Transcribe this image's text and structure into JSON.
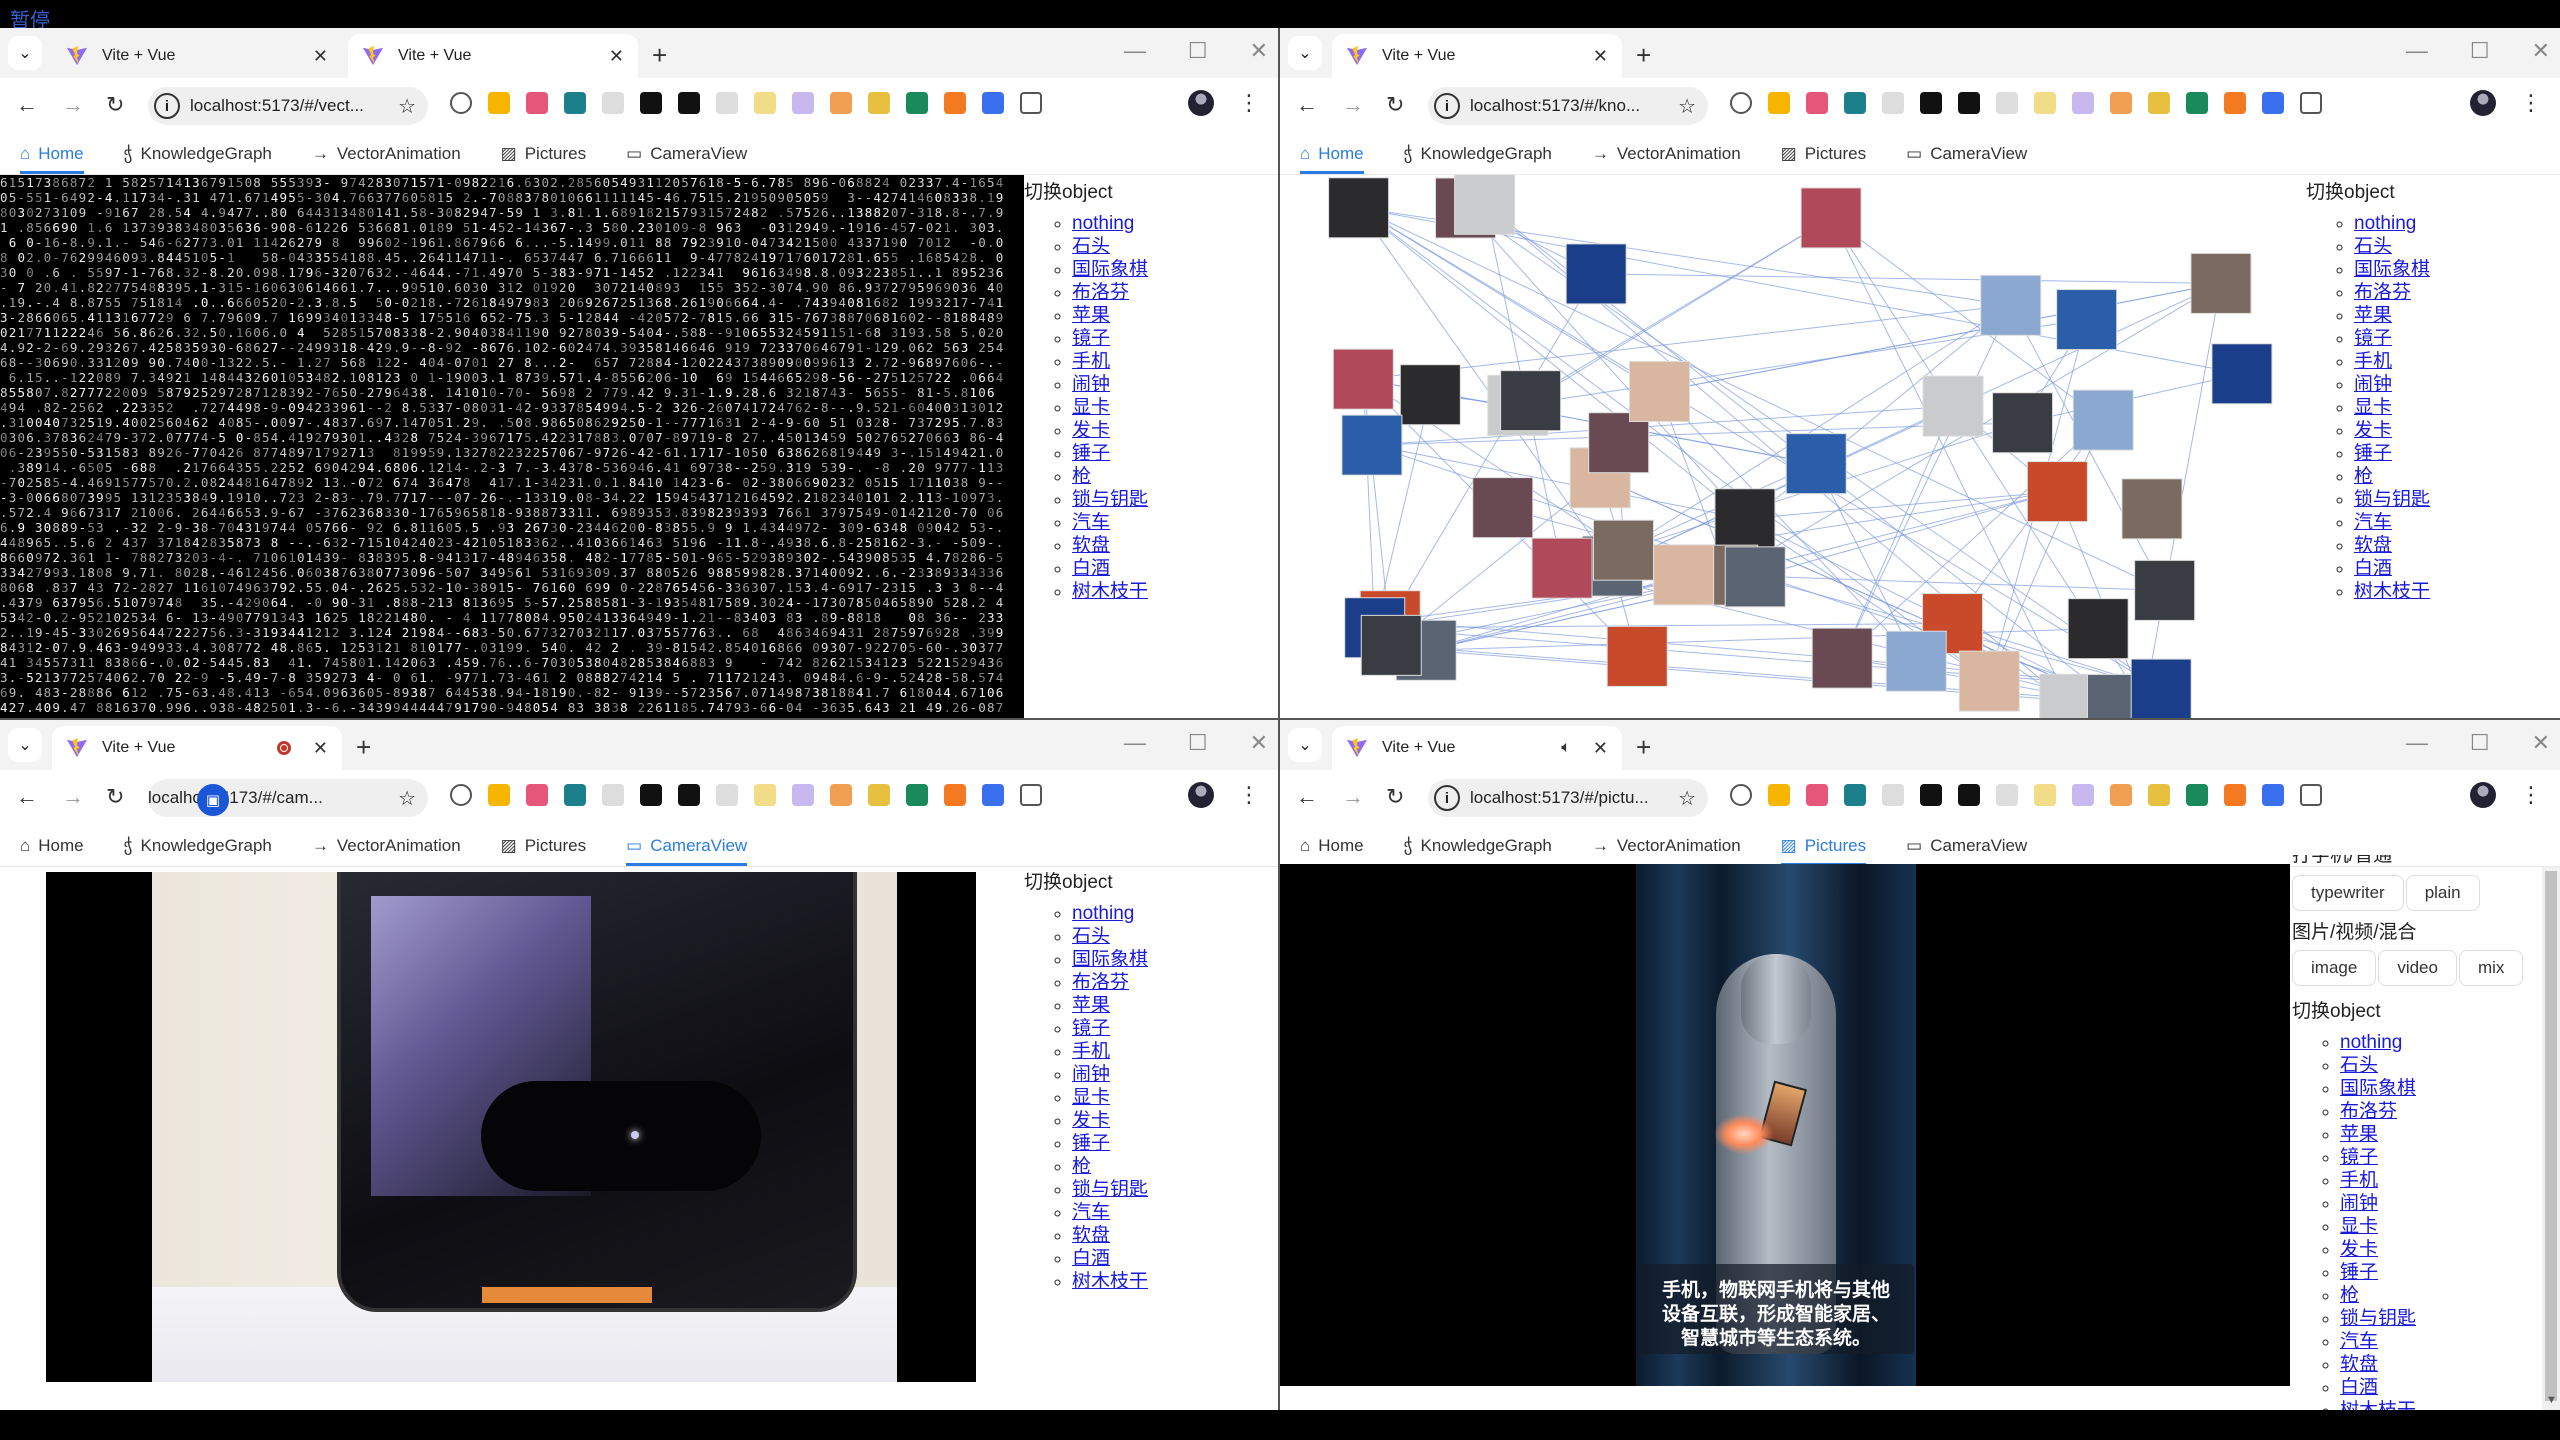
{
  "screen": {
    "status_label": "暂停"
  },
  "tab_title": "Vite + Vue",
  "nav": [
    {
      "label": "Home",
      "icon": "home-icon"
    },
    {
      "label": "KnowledgeGraph",
      "icon": "graph-icon"
    },
    {
      "label": "VectorAnimation",
      "icon": "arrow-right-icon"
    },
    {
      "label": "Pictures",
      "icon": "image-icon"
    },
    {
      "label": "CameraView",
      "icon": "camera-icon"
    }
  ],
  "windows": [
    {
      "url": "localhost:5173/#/vect...",
      "active_nav": "Home",
      "tabs": [
        "Vite + Vue",
        "Vite + Vue"
      ]
    },
    {
      "url": "localhost:5173/#/kno...",
      "active_nav": "Home",
      "tabs": [
        "Vite + Vue"
      ]
    },
    {
      "url": "localhost:5173/#/cam...",
      "active_nav": "CameraView",
      "tabs": [
        "Vite + Vue"
      ],
      "tab_indicator": "recording"
    },
    {
      "url": "localhost:5173/#/pictu...",
      "active_nav": "Pictures",
      "tabs": [
        "Vite + Vue"
      ],
      "tab_indicator": "audio"
    }
  ],
  "extensions": [
    "mouse-ext",
    "bulb-ext",
    "translate-ext",
    "bug-ext",
    "doc-ext",
    "glasses-ext",
    "arc-ext",
    "markdown-ext",
    "m-ext",
    "select-ext",
    "orange-ext",
    "yellow-file-ext",
    "green-file-ext",
    "search-ext",
    "blue-ext",
    "puzzle-ext"
  ],
  "object_panel": {
    "title": "切换object",
    "items": [
      "nothing",
      "石头",
      "国际象棋",
      "布洛芬",
      "苹果",
      "镜子",
      "手机",
      "闹钟",
      "显卡",
      "发卡",
      "锤子",
      "枪",
      "锁与钥匙",
      "汽车",
      "软盘",
      "白酒",
      "树木枝干"
    ]
  },
  "pictures_panel": {
    "text_mode_label": "打字机/普通",
    "text_modes": [
      "typewriter",
      "plain"
    ],
    "media_label": "图片/视频/混合",
    "media_modes": [
      "image",
      "video",
      "mix"
    ],
    "caption": "手机，物联网手机将与其他设备互联，形成智能家居、智慧城市等生态系统。"
  },
  "colors": {
    "accent": "#2a7ce0",
    "link": "#1a1adb",
    "graph_edge": "#7f9be0"
  }
}
